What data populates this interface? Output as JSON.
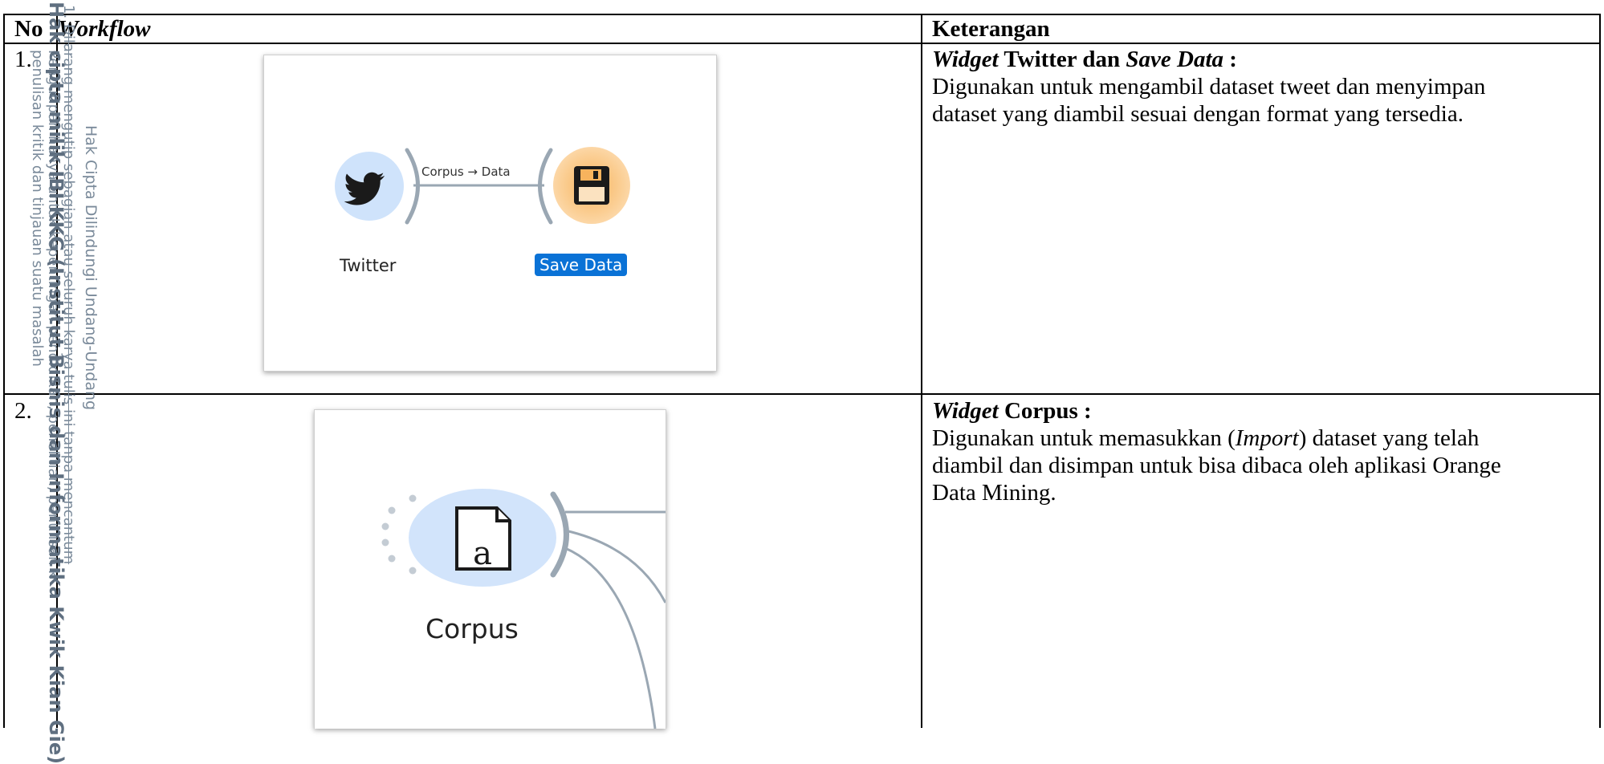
{
  "table": {
    "headers": {
      "no": "No",
      "workflow": "Workflow",
      "keterangan": "Keterangan"
    },
    "rows": [
      {
        "no": "1.",
        "widgets": {
          "left_label": "Twitter",
          "right_label": "Save Data",
          "link_label": "Corpus → Data"
        },
        "desc_title_italic": "Widget",
        "desc_title_bold": " Twitter dan ",
        "desc_title_italic2": "Save Data",
        "desc_title_colon": " :",
        "desc_lines": [
          "Digunakan untuk mengambil dataset tweet dan menyimpan",
          "dataset yang diambil sesuai dengan format yang tersedia."
        ]
      },
      {
        "no": "2.",
        "widgets": {
          "label": "Corpus"
        },
        "desc_title_italic": "Widget",
        "desc_title_bold": " Corpus :",
        "desc_line1_pre": "Digunakan untuk memasukkan (",
        "desc_line1_italic": "Import",
        "desc_line1_post": ") dataset yang telah",
        "desc_lines": [
          "diambil dan disimpan untuk bisa dibaca oleh aplikasi Orange",
          "Data Mining."
        ]
      }
    ]
  },
  "watermark": {
    "line_num": "1.",
    "line1_strike": "Dilarang mengutip sebagian atau seluruh karya tulis ini tanpa mencantum",
    "line1b": "Pengutipan hanya untuk kepentingan pendidikan, penelitian, penulisan k",
    "line1c": "penulisan kritik dan tinjauan suatu masalah",
    "line2": "Hak Cipta Dilindungi Undang-Undang",
    "line3": "Hak cipta milik IBI KKG (Institut Bisnis dan Informatika Kwik Kian Gie)"
  }
}
